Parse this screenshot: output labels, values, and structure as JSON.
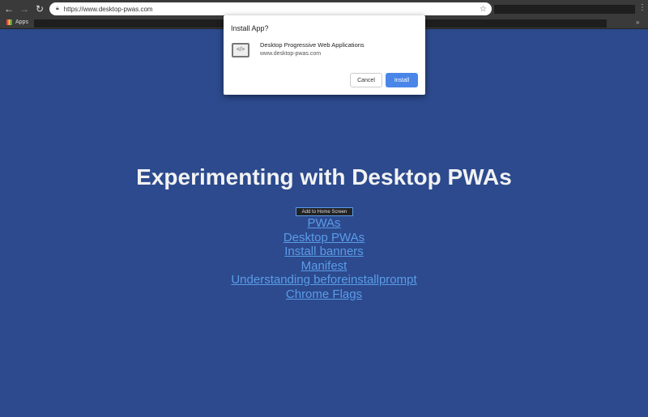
{
  "browser": {
    "url": "https://www.desktop-pwas.com",
    "bookmarks_apps_label": "Apps",
    "icons": [
      "back-icon",
      "forward-icon",
      "reload-icon",
      "lock-icon",
      "star-icon",
      "menu-icon",
      "apps-grid-icon",
      "chevron-double-right-icon"
    ]
  },
  "dialog": {
    "title": "Install App?",
    "app_name": "Desktop Progressive Web Applications",
    "app_url": "www.desktop-pwas.com",
    "cancel_label": "Cancel",
    "install_label": "Install",
    "accent": "#4a86e8"
  },
  "page": {
    "heading": "Experimenting with Desktop PWAs",
    "add_button": "Add to Home Screen",
    "links": [
      "PWAs",
      "Desktop PWAs",
      "Install banners",
      "Manifest",
      "Understanding beforeinstallprompt",
      "Chrome Flags"
    ],
    "background": "#2c4a8d",
    "link_color": "#5b9ce9"
  }
}
